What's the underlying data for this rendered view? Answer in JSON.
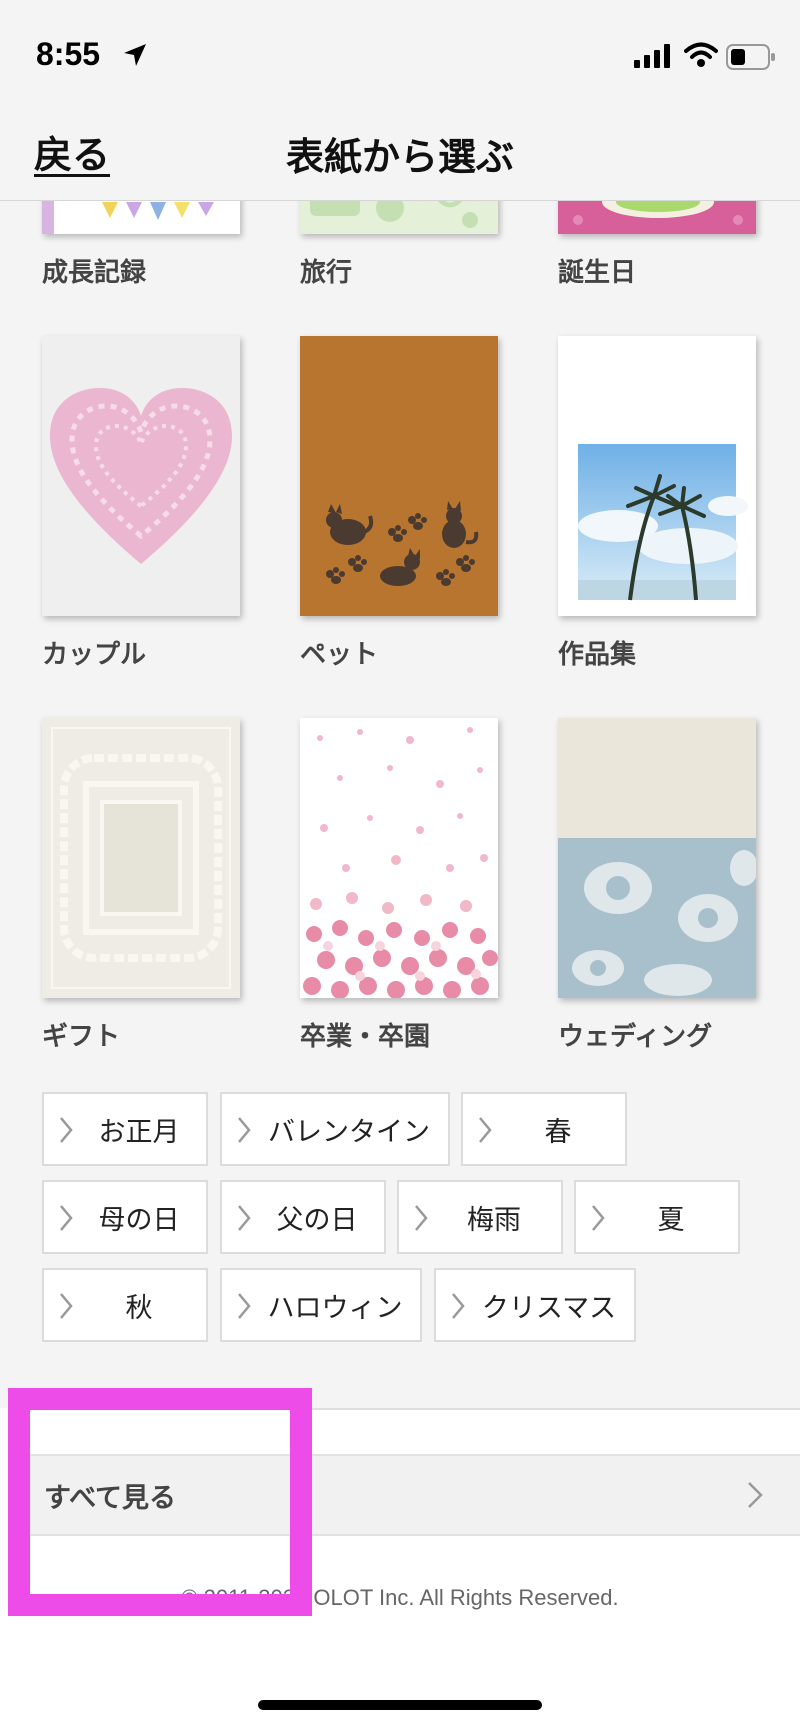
{
  "status_bar": {
    "time": "8:55"
  },
  "nav": {
    "back_label": "戻る",
    "title": "表紙から選ぶ"
  },
  "covers_row1": [
    {
      "label": "成長記録"
    },
    {
      "label": "旅行"
    },
    {
      "label": "誕生日"
    }
  ],
  "covers_row2": [
    {
      "label": "カップル"
    },
    {
      "label": "ペット"
    },
    {
      "label": "作品集"
    }
  ],
  "covers_row3": [
    {
      "label": "ギフト"
    },
    {
      "label": "卒業・卒園"
    },
    {
      "label": "ウェディング"
    }
  ],
  "tags": [
    {
      "label": "お正月"
    },
    {
      "label": "バレンタイン"
    },
    {
      "label": "春"
    },
    {
      "label": "母の日"
    },
    {
      "label": "父の日"
    },
    {
      "label": "梅雨"
    },
    {
      "label": "夏"
    },
    {
      "label": "秋"
    },
    {
      "label": "ハロウィン"
    },
    {
      "label": "クリスマス"
    }
  ],
  "see_all": {
    "label": "すべて見る"
  },
  "footer": {
    "copyright": "© 2011-2022 OLOT Inc. All Rights Reserved."
  },
  "colors": {
    "highlight": "#ee4ce8",
    "pet_cover": "#b8752f",
    "sky": "#8cc4ec",
    "damask": "#a7c0cc"
  }
}
